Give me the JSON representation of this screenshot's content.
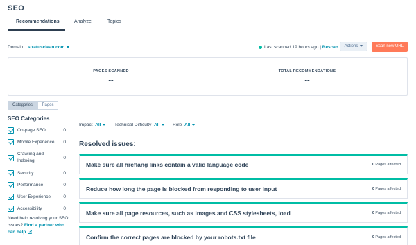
{
  "page": {
    "title": "SEO"
  },
  "tabs": [
    {
      "label": "Recommendations",
      "active": true
    },
    {
      "label": "Analyze",
      "active": false
    },
    {
      "label": "Topics",
      "active": false
    }
  ],
  "domain": {
    "label": "Domain:",
    "value": "stratusclean.com"
  },
  "scan_status": {
    "last_scanned": "Last scanned 19 hours ago",
    "separator": "|",
    "rescan_label": "Rescan now",
    "status_color": "#00bda5"
  },
  "buttons": {
    "actions_label": "Actions",
    "scan_new_url_label": "Scan new URL",
    "scan_color": "#ff7a59"
  },
  "stats": {
    "pages_scanned_label": "PAGES SCANNED",
    "pages_scanned_value": "--",
    "total_recommendations_label": "TOTAL RECOMMENDATIONS",
    "total_recommendations_value": "--"
  },
  "view_toggle": {
    "categories_label": "Categories",
    "pages_label": "Pages",
    "active": "Categories"
  },
  "categories": {
    "heading": "SEO Categories",
    "items": [
      {
        "label": "On-page SEO",
        "count": "0",
        "checked": true
      },
      {
        "label": "Mobile Experience",
        "count": "0",
        "checked": true
      },
      {
        "label": "Crawling and Indexing",
        "count": "0",
        "checked": true
      },
      {
        "label": "Security",
        "count": "0",
        "checked": true
      },
      {
        "label": "Performance",
        "count": "0",
        "checked": true
      },
      {
        "label": "User Experience",
        "count": "0",
        "checked": true
      },
      {
        "label": "Accessibility",
        "count": "0",
        "checked": true
      }
    ]
  },
  "help": {
    "text": "Need help resolving your SEO issues?",
    "link_label": "Find a partner who can help"
  },
  "filters": {
    "impact_label": "Impact",
    "impact_value": "All",
    "difficulty_label": "Technical Difficulty",
    "difficulty_value": "All",
    "role_label": "Role",
    "role_value": "All"
  },
  "resolved": {
    "heading": "Resolved issues:",
    "accent_color": "#00bda5",
    "issues": [
      {
        "title": "Make sure all hreflang links contain a valid language code",
        "count": "0",
        "suffix": "Pages affected"
      },
      {
        "title": "Reduce how long the page is blocked from responding to user input",
        "count": "0",
        "suffix": "Pages affected"
      },
      {
        "title": "Make sure all page resources, such as images and CSS stylesheets, load",
        "count": "0",
        "suffix": "Pages affected"
      },
      {
        "title": "Confirm the correct pages are blocked by your robots.txt file",
        "count": "0",
        "suffix": "Pages affected"
      }
    ]
  }
}
